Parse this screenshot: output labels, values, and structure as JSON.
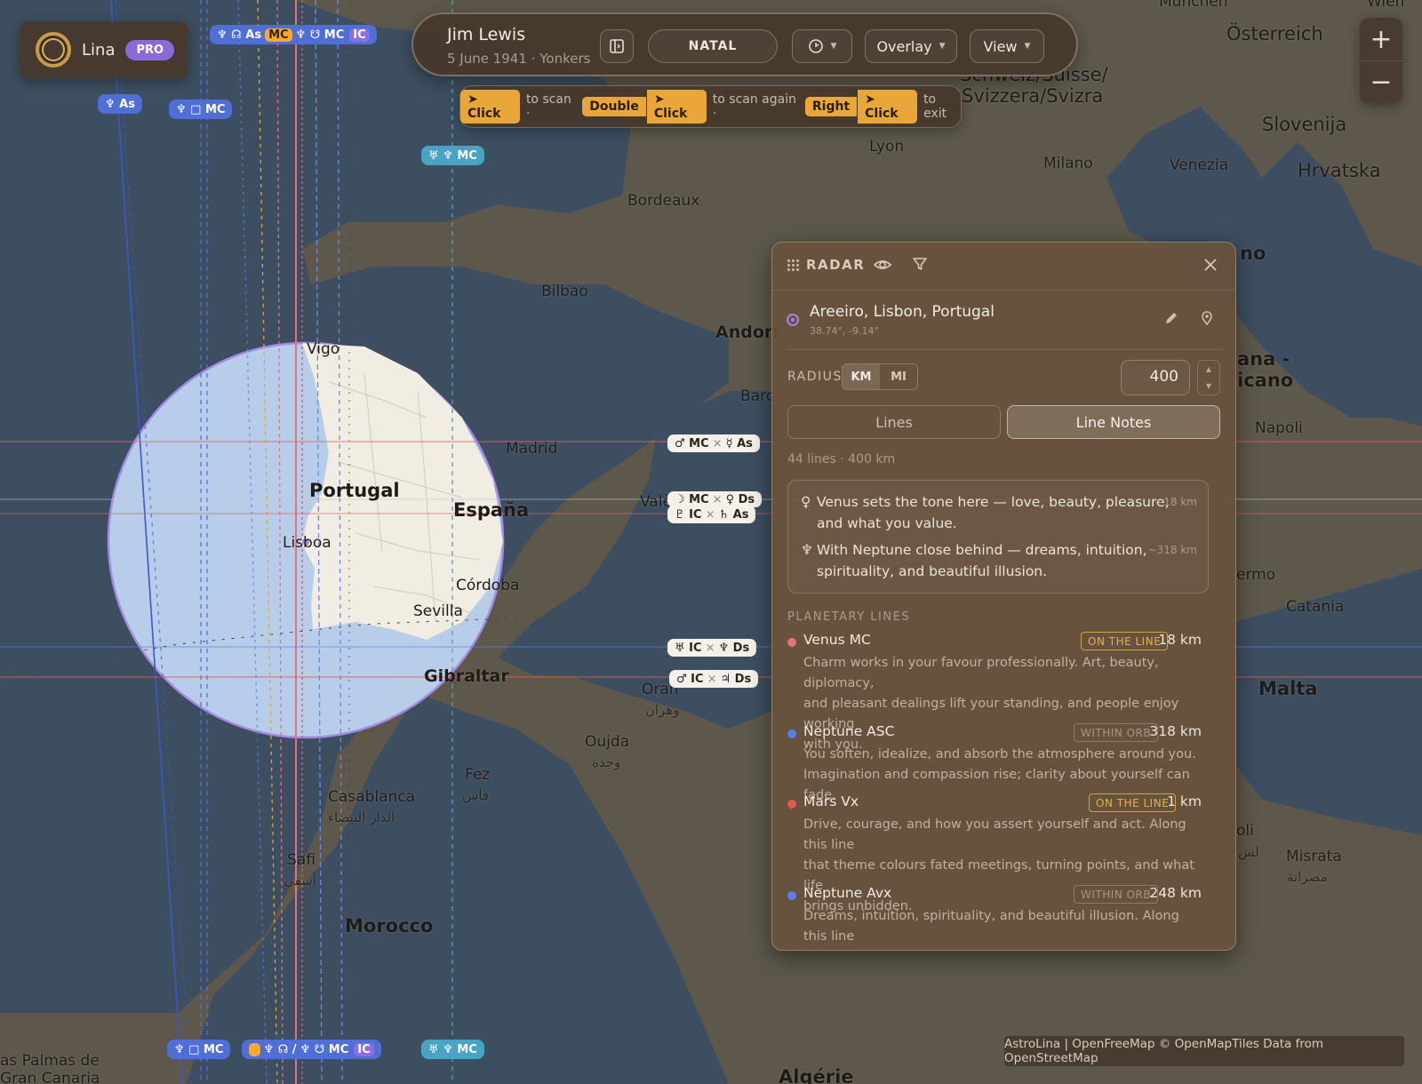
{
  "brand": {
    "name": "Lina",
    "badge": "PRO"
  },
  "chart": {
    "person": "Jim Lewis",
    "birth": "5 June 1941 · Yonkers",
    "mode": "NATAL",
    "overlay": "Overlay",
    "view": "View"
  },
  "hint": {
    "k1": "➤ Click",
    "t1": "to scan ·",
    "k2": "Double",
    "k3": "➤ Click",
    "t2": "to scan again ·",
    "k4": "Right",
    "k5": "➤ Click",
    "t3": "to exit"
  },
  "zoom": {
    "in": "+",
    "out": "−"
  },
  "map_labels": {
    "munchen": "München",
    "wien": "Wien",
    "osterreich": "Österreich",
    "schweiz1": "Schweiz/Suisse/",
    "schweiz2": "Svizzera/Svizra",
    "slovenija": "Slovenija",
    "hrvatska": "Hrvatska",
    "lyon": "Lyon",
    "milano": "Milano",
    "venezia": "Venezia",
    "bordeaux": "Bordeaux",
    "bilbao": "Bilbao",
    "andorra": "Andorr",
    "barcelona": "Barc",
    "vigo": "Vigo",
    "portugal": "Portugal",
    "espana": "España",
    "madrid": "Madrid",
    "valencia": "Valè",
    "lisboa": "Lisboa",
    "cordoba": "Córdoba",
    "sevilla": "Sevilla",
    "gibraltar": "Gibraltar",
    "oran": "Oran",
    "oran_ar": "وهران",
    "oujda": "Oujda",
    "oujda_ar": "وجدة",
    "fez": "Fez",
    "fez_ar": "فاس",
    "casablanca": "Casablanca",
    "casablanca_ar": "الدار البيضاء",
    "safi": "Safi",
    "safi_ar": "أسفي",
    "morocco": "Morocco",
    "algerie": "Algérie",
    "palmas1": "as Palmas de",
    "palmas2": "Gran Canaria",
    "napoli": "Napoli",
    "catania": "Catania",
    "malta": "Malta",
    "misrata": "Misrata",
    "misrata_ar": "مصراتة",
    "palermo": "ermo",
    "tripoli": "oli",
    "tripoli_ar": "لس",
    "ano": "no",
    "sanmarino1": "ana -",
    "sanmarino2": "icano"
  },
  "chips": {
    "c1": "♆ ☊ As",
    "c1b": "MC",
    "c1c": "♆ ☋ MC",
    "c1d": "IC",
    "c2": "♆ As",
    "c3": "♆ □ MC",
    "c4": "♅ ♆ MC",
    "c5a": "♂ MC",
    "c5b": "☿ As",
    "c6a": "☽ MC",
    "c6b": "♀ Ds",
    "c7a": "♇ IC",
    "c7b": "♄ As",
    "c8a": "♅ IC",
    "c8b": "♆ Ds",
    "c9a": "♂ IC",
    "c9b": "♃ Ds",
    "c10": "♆ □ MC",
    "c11": "♆ ☊ /",
    "c11b": "♆ ☋ MC",
    "c11c": "IC",
    "c12": "♅ ♆ MC",
    "cross": "×"
  },
  "radar": {
    "title": "RADAR",
    "location": "Areeiro, Lisbon, Portugal",
    "coords": "38.74°, -9.14°",
    "radius_label": "RADIUS",
    "unit_km": "KM",
    "unit_mi": "MI",
    "radius_value": "400",
    "tab_lines": "Lines",
    "tab_notes": "Line Notes",
    "summary": "44 lines · 400 km",
    "notes": [
      {
        "glyph": "♀",
        "text1": "Venus sets the tone here — love, beauty, pleasure,",
        "text2": "and what you value.",
        "dist": "~18 km"
      },
      {
        "glyph": "♆",
        "text1": "With Neptune close behind — dreams, intuition,",
        "text2": "spirituality, and beautiful illusion.",
        "dist": "~318 km"
      }
    ],
    "section": "PLANETARY LINES",
    "lines": [
      {
        "name": "Venus MC",
        "badge": "ON THE LINE",
        "dist": "18 km",
        "color": "#e8707e",
        "d1": "Charm works in your favour professionally. Art, beauty, diplomacy,",
        "d2": "and pleasant dealings lift your standing, and people enjoy working",
        "d3": "with you."
      },
      {
        "name": "Neptune ASC",
        "badge": "WITHIN ORB",
        "dist": "318 km",
        "color": "#5b7ee8",
        "d1": "You soften, idealize, and absorb the atmosphere around you.",
        "d2": "Imagination and compassion rise; clarity about yourself can fade.",
        "d3": ""
      },
      {
        "name": "Mars Vx",
        "badge": "ON THE LINE",
        "dist": "1 km",
        "color": "#e05b4f",
        "d1": "Drive, courage, and how you assert yourself and act. Along this line",
        "d2": "that theme colours fated meetings, turning points, and what life",
        "d3": "brings unbidden."
      },
      {
        "name": "Neptune Avx",
        "badge": "WITHIN ORB",
        "dist": "248 km",
        "color": "#5b7ee8",
        "d1": "Dreams, intuition, spirituality, and beautiful illusion. Along this line",
        "d2": "",
        "d3": ""
      }
    ]
  },
  "attribution": "AstroLina | OpenFreeMap © OpenMapTiles Data from OpenStreetMap"
}
